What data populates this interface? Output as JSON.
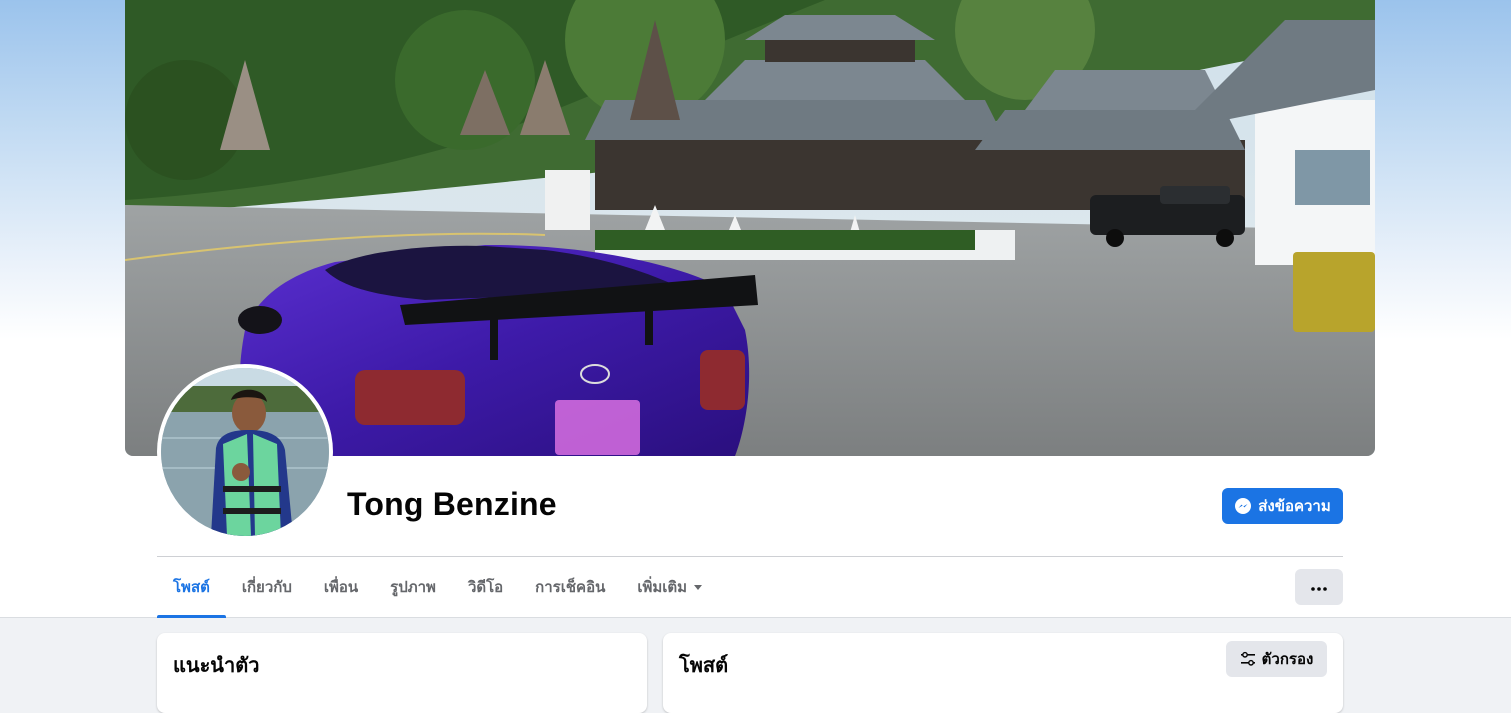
{
  "profile": {
    "name": "Tong Benzine",
    "message_button": "ส่งข้อความ"
  },
  "tabs": [
    {
      "label": "โพสต์",
      "active": true
    },
    {
      "label": "เกี่ยวกับ",
      "active": false
    },
    {
      "label": "เพื่อน",
      "active": false
    },
    {
      "label": "รูปภาพ",
      "active": false
    },
    {
      "label": "วิดีโอ",
      "active": false
    },
    {
      "label": "การเช็คอิน",
      "active": false
    },
    {
      "label": "เพิ่มเติม",
      "active": false
    }
  ],
  "intro_card": {
    "title": "แนะนำตัว"
  },
  "posts_card": {
    "title": "โพสต์",
    "filter_label": "ตัวกรอง"
  },
  "icons": {
    "message": "messenger-icon",
    "more_tab": "caret-down-icon",
    "options": "more-horizontal-icon",
    "filter": "filter-sliders-icon"
  },
  "colors": {
    "accent": "#1b74e4",
    "page_bg": "#f0f2f5",
    "secondary_button": "#e4e6eb",
    "muted_text": "#65676b"
  }
}
